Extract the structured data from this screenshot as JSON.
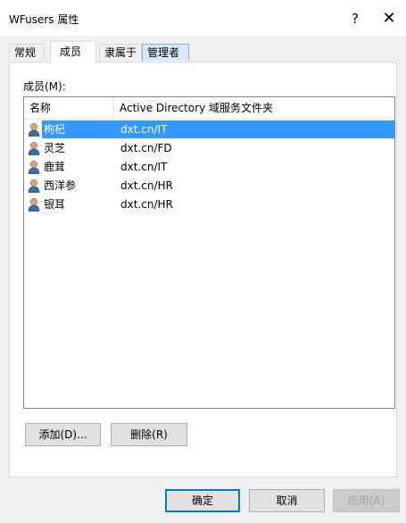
{
  "window": {
    "title": "WFusers 属性",
    "help_glyph": "?",
    "close_glyph": "✕"
  },
  "tabs": [
    {
      "label": "常规"
    },
    {
      "label": "成员"
    },
    {
      "label": "隶属于"
    },
    {
      "label": "管理者"
    }
  ],
  "members_label": "成员(M):",
  "list": {
    "columns": [
      "名称",
      "Active Directory 域服务文件夹"
    ],
    "rows": [
      {
        "name": "枸杞",
        "folder": "dxt.cn/IT"
      },
      {
        "name": "灵芝",
        "folder": "dxt.cn/FD"
      },
      {
        "name": "鹿茸",
        "folder": "dxt.cn/IT"
      },
      {
        "name": "西洋参",
        "folder": "dxt.cn/HR"
      },
      {
        "name": "银耳",
        "folder": "dxt.cn/HR"
      }
    ]
  },
  "buttons": {
    "add": "添加(D)...",
    "remove": "删除(R)",
    "ok": "确定",
    "cancel": "取消",
    "apply": "应用(A)"
  },
  "colors": {
    "selection": "#3399ff",
    "default_button_border": "#0078d7",
    "dialog_background": "#f0f0f0"
  },
  "icons": {
    "row_icon": "user-icon"
  }
}
